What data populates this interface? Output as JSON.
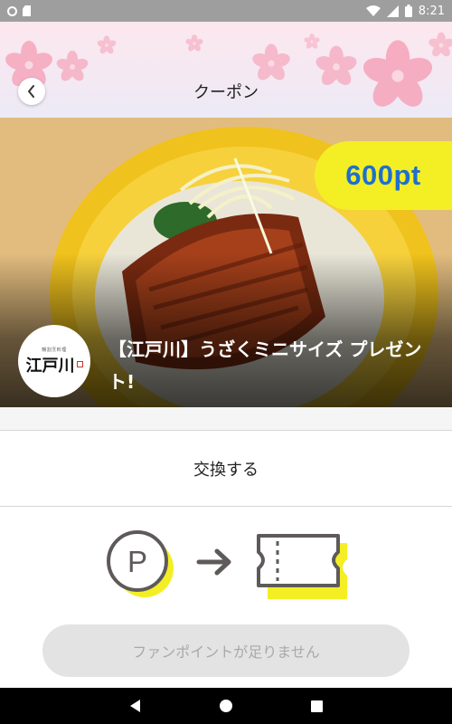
{
  "status_bar": {
    "time": "8:21"
  },
  "header": {
    "title": "クーポン"
  },
  "coupon": {
    "points": "600pt",
    "title": "【江戸川】うざくミニサイズ プレゼント!",
    "shop_logo": {
      "brand": "江戸川",
      "tagline": "鰻割烹料理"
    }
  },
  "exchange": {
    "label": "交換する"
  },
  "cta": {
    "label": "ファンポイントが足りません"
  },
  "colors": {
    "accent_yellow": "#f3ef24",
    "points_blue": "#1e6fd0",
    "disabled_bg": "#e3e3e3"
  },
  "icons": [
    "back-chevron-icon",
    "points-p-icon",
    "arrow-right-icon",
    "ticket-icon",
    "wifi-icon",
    "signal-icon",
    "battery-icon",
    "nav-back-icon",
    "nav-home-icon",
    "nav-recents-icon"
  ]
}
